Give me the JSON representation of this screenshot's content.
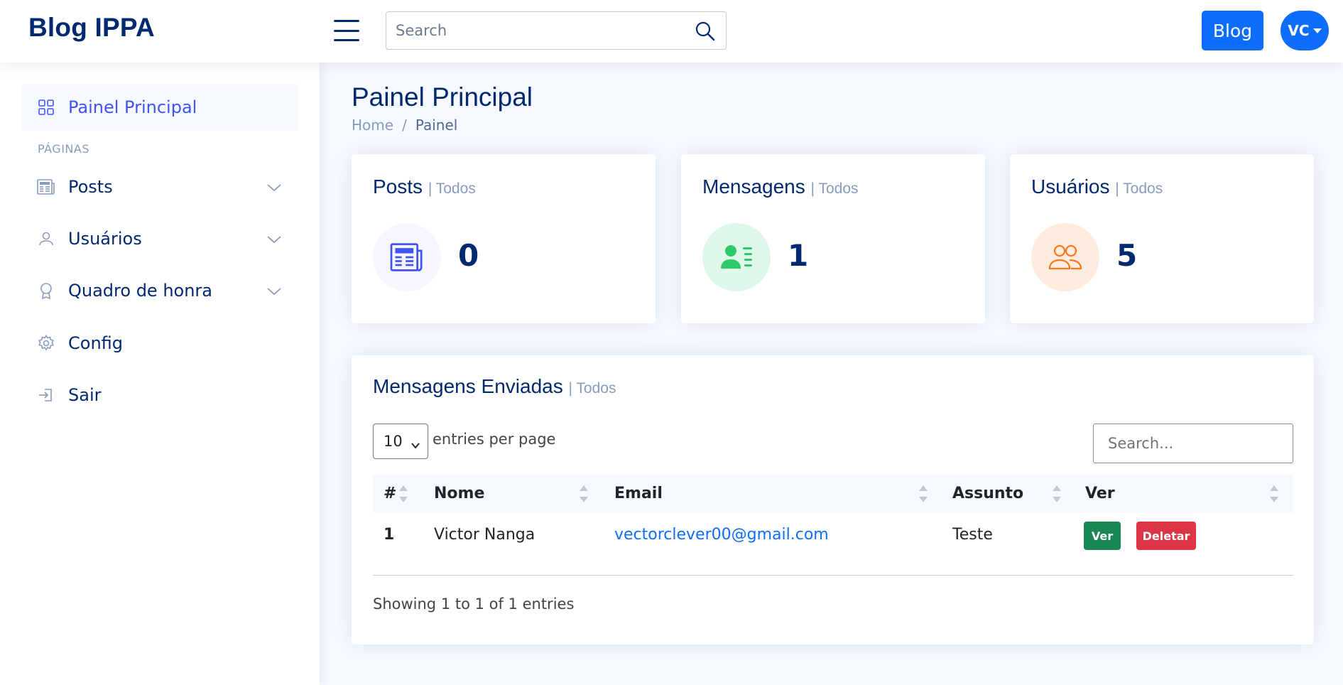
{
  "header": {
    "logo": "Blog IPPA",
    "search_placeholder": "Search",
    "blog_button": "Blog",
    "avatar_initials": "VC"
  },
  "sidebar": {
    "dashboard_label": "Painel Principal",
    "section_heading": "PÁGINAS",
    "items": [
      {
        "label": "Posts",
        "icon": "newspaper-icon",
        "has_submenu": true
      },
      {
        "label": "Usuários",
        "icon": "person-icon",
        "has_submenu": true
      },
      {
        "label": "Quadro de honra",
        "icon": "award-icon",
        "has_submenu": true
      },
      {
        "label": "Config",
        "icon": "gear-icon",
        "has_submenu": false
      },
      {
        "label": "Sair",
        "icon": "sign-in-icon",
        "has_submenu": false
      }
    ]
  },
  "page": {
    "title": "Painel Principal",
    "breadcrumb_home": "Home",
    "breadcrumb_sep": "/",
    "breadcrumb_current": "Painel"
  },
  "cards": [
    {
      "title": "Posts",
      "filter": "| Todos",
      "value": "0",
      "icon": "newspaper-icon",
      "icon_color": "#4154f1",
      "icon_bg": "#f6f6fe"
    },
    {
      "title": "Mensagens",
      "filter": "| Todos",
      "value": "1",
      "icon": "person-lines-icon",
      "icon_color": "#2eca6a",
      "icon_bg": "#e0f8e9"
    },
    {
      "title": "Usuários",
      "filter": "| Todos",
      "value": "5",
      "icon": "people-icon",
      "icon_color": "#ff771d",
      "icon_bg": "#ffecdf"
    }
  ],
  "messages_table": {
    "title": "Mensagens Enviadas",
    "filter": "| Todos",
    "per_page_value": "10",
    "per_page_label": "entries per page",
    "search_placeholder": "Search...",
    "columns": [
      "#",
      "Nome",
      "Email",
      "Assunto",
      "Ver"
    ],
    "rows": [
      {
        "num": "1",
        "nome": "Victor Nanga",
        "email": "vectorclever00@gmail.com",
        "assunto": "Teste",
        "view_label": "Ver",
        "delete_label": "Deletar"
      }
    ],
    "info": "Showing 1 to 1 of 1 entries"
  },
  "colors": {
    "primary": "#4154f1",
    "navy": "#012970",
    "button_blue": "#0d6efd",
    "success": "#198754",
    "danger": "#dc3545"
  }
}
